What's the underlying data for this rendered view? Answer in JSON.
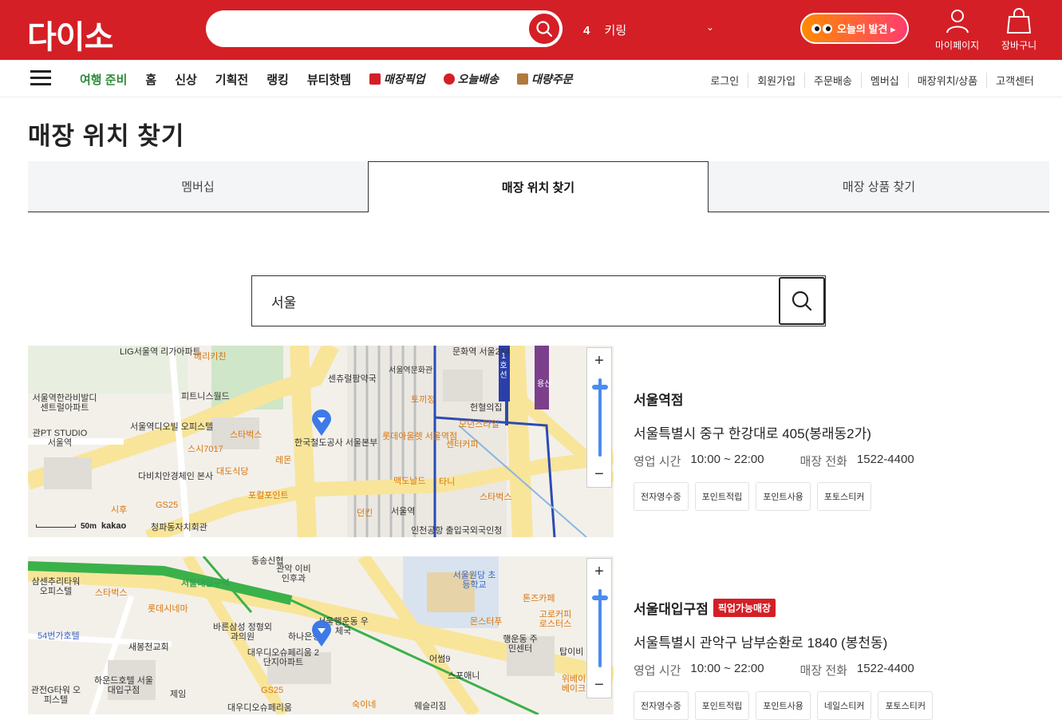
{
  "header": {
    "logo": "다이소",
    "search_placeholder": "",
    "rank_number": "4",
    "rank_keyword": "키링",
    "discover_label": "오늘의 발견 ▸",
    "mypage_label": "마이페이지",
    "cart_label": "장바구니",
    "brand_color": "#d41f26"
  },
  "nav": {
    "items": [
      "여행 준비",
      "홈",
      "신상",
      "기획전",
      "랭킹",
      "뷰티핫템",
      "매장픽업",
      "오늘배송",
      "대량주문"
    ],
    "util": [
      "로그인",
      "회원가입",
      "주문배송",
      "멤버십",
      "매장위치/상품",
      "고객센터"
    ]
  },
  "page": {
    "title": "매장 위치 찾기"
  },
  "tabs": [
    {
      "label": "멤버십",
      "active": false
    },
    {
      "label": "매장 위치 찾기",
      "active": true
    },
    {
      "label": "매장 상품 찾기",
      "active": false
    }
  ],
  "store_search": {
    "value": "서울"
  },
  "meta_labels": {
    "hours": "영업 시간",
    "phone": "매장 전화"
  },
  "stores": [
    {
      "name": "서울역점",
      "badge": "",
      "address": "서울특별시 중구 한강대로 405(봉래동2가)",
      "hours": "10:00 ~ 22:00",
      "phone": "1522-4400",
      "tags": [
        "전자영수증",
        "포인트적립",
        "포인트사용",
        "포토스티커"
      ],
      "map": {
        "scale": "50m",
        "brand": "kakao",
        "labels": [
          "LIG서울역 리가아파트",
          "베리키친",
          "센츄럴팜약국",
          "서울역문화관",
          "문화역 서울284",
          "토끼정",
          "헌혈의집",
          "피트니스월드",
          "서울역디오빌 오피스텔",
          "스타벅스",
          "한국철도공사 서울본부",
          "롯데아울렛 서울역점",
          "모던스타일",
          "센터커피",
          "스시7017",
          "레몬",
          "다비치안경체인 본사",
          "대도식당",
          "맥도날드",
          "타니",
          "포컬포인트",
          "GS25",
          "시후",
          "던킨",
          "서울역",
          "스타벅스",
          "청파동자치회관",
          "서울역한라비발디 센트럴아파트",
          "관PT STUDIO 서울역",
          "인천공항 출입국외국인청",
          "1호선",
          "용산"
        ]
      }
    },
    {
      "name": "서울대입구점",
      "badge": "픽업가능매장",
      "address": "서울특별시 관악구 남부순환로 1840 (봉천동)",
      "hours": "10:00 ~ 22:00",
      "phone": "1522-4400",
      "tags": [
        "전자영수증",
        "포인트적립",
        "포인트사용",
        "네일스티커",
        "포토스티커"
      ],
      "map": {
        "labels": [
          "동송신협",
          "관악 이비인후과",
          "서울원당 초등학교",
          "톤즈카페",
          "삼센추리타워 오피스텔",
          "스타벅스",
          "서울대입구역",
          "롯데시네마",
          "서울행운동 우체국",
          "몬스터푸",
          "고로커피 로스터스",
          "54번가호텔",
          "바른삼성 정형외과의원",
          "하나은행",
          "새봉천교회",
          "대우디오슈페리움 2단지아파트",
          "어썸9",
          "행운동 주민센터",
          "탑이비",
          "하운드호텔 서울대입구점",
          "스포애니",
          "위베이 베이크",
          "관전G타워 오피스텔",
          "제임",
          "GS25",
          "숙이네",
          "웨슬리짐",
          "대우디오슈페리움"
        ]
      }
    }
  ]
}
